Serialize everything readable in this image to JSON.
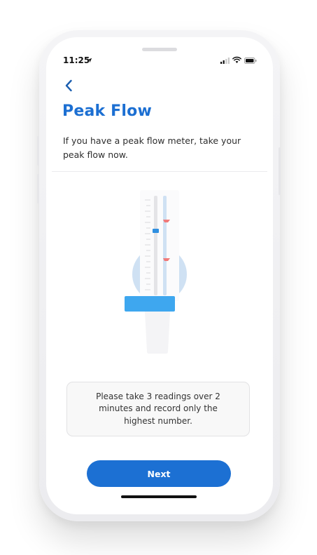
{
  "status_bar": {
    "time": "11:25",
    "location_icon": "location-arrow-icon",
    "signal_icon": "cellular-signal-icon",
    "wifi_icon": "wifi-icon",
    "battery_icon": "battery-icon"
  },
  "header": {
    "back_icon": "chevron-left-icon",
    "title": "Peak Flow",
    "subtitle": "If you have a peak flow meter, take your peak flow now."
  },
  "illustration": {
    "icon": "peak-flow-meter-icon"
  },
  "info_card": {
    "text": "Please take 3 readings over 2 minutes and record only the highest number."
  },
  "actions": {
    "next_label": "Next"
  },
  "colors": {
    "accent": "#1c6fd2",
    "button": "#1c70d3",
    "meter_light_blue": "#cfe1f3",
    "meter_mouthpiece": "#3ea7ef",
    "marker_red": "#f07a7a"
  }
}
